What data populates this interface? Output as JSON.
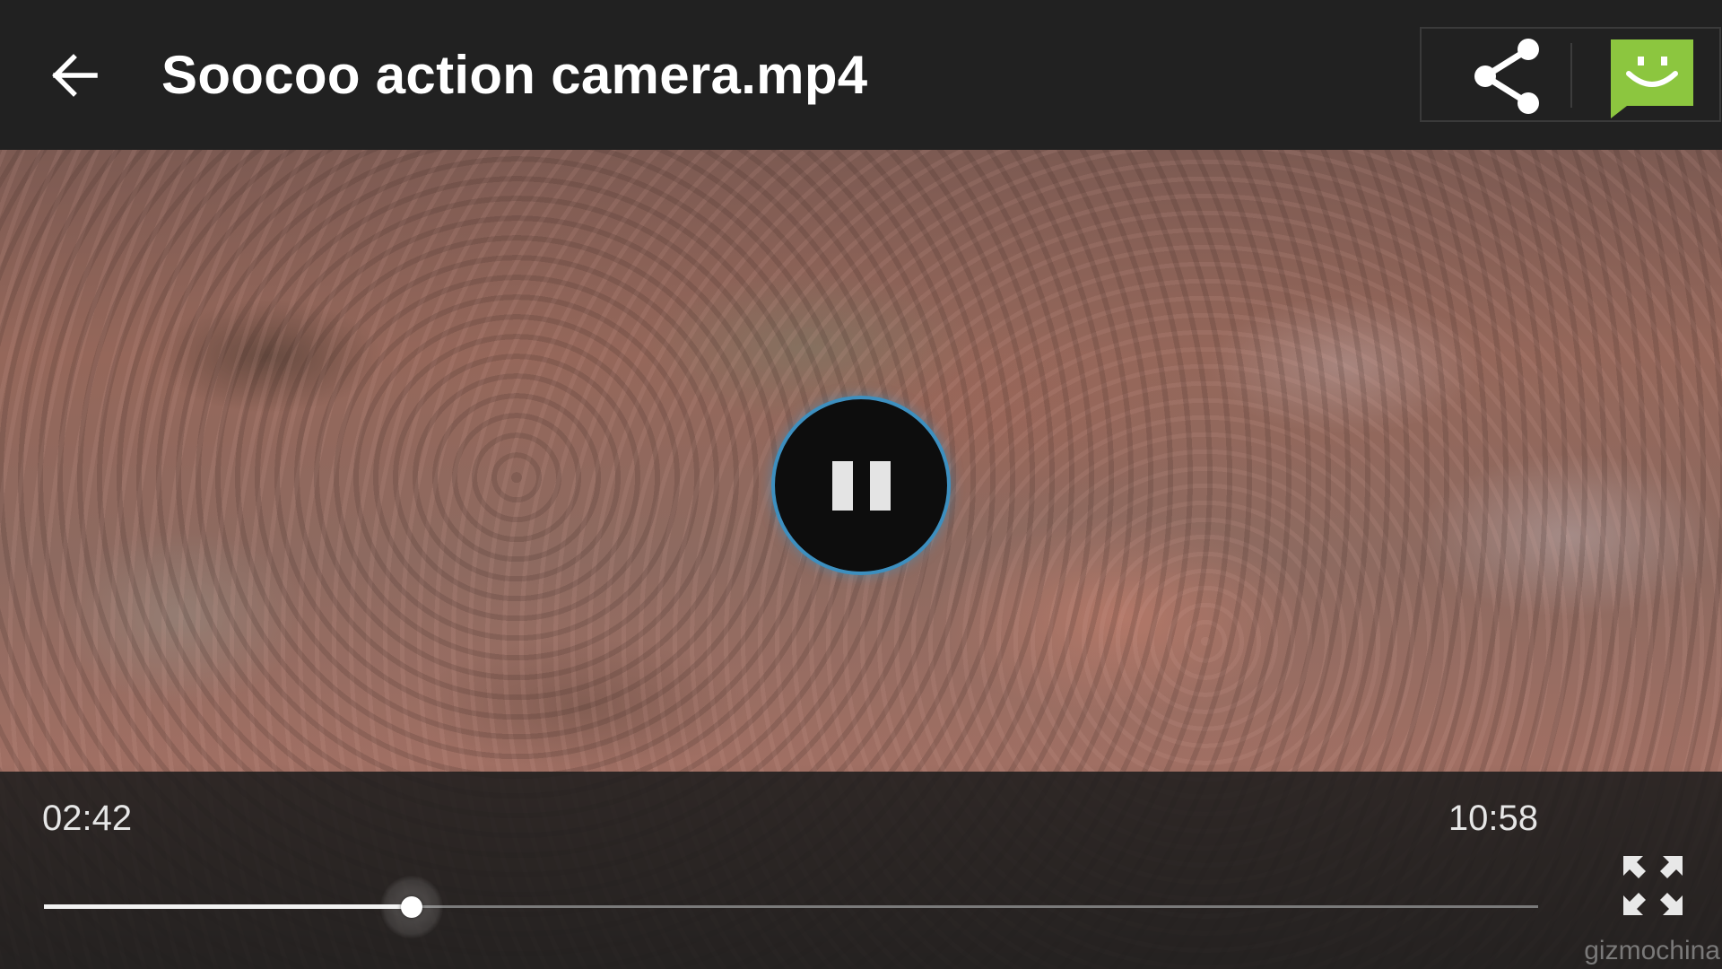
{
  "header": {
    "title": "Soocoo action camera.mp4",
    "back_icon": "arrow-left-icon",
    "share_icon": "share-icon",
    "message_icon": "smiley-message-icon",
    "message_color": "#8cc63f",
    "background_color": "#212121"
  },
  "player": {
    "state": "playing",
    "pause_icon": "pause-icon",
    "button_ring_color": "#3d8fbf"
  },
  "controls": {
    "elapsed": "02:42",
    "total": "10:58",
    "progress": 0.246,
    "fullscreen_icon": "fullscreen-icon"
  },
  "watermark": "gizmochina"
}
